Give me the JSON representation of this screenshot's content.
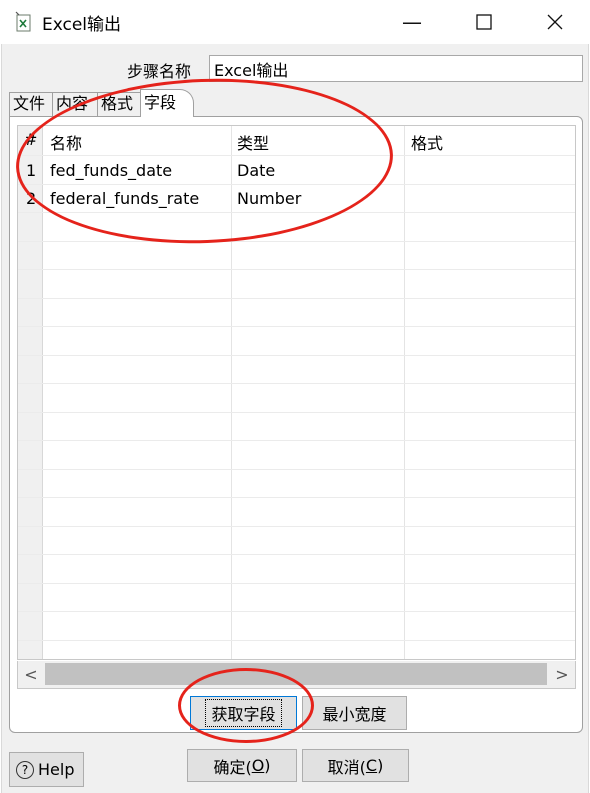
{
  "window": {
    "title": "Excel输出",
    "minimize_glyph": "—",
    "maximize_glyph": "☐",
    "close_glyph": "✕"
  },
  "step": {
    "label": "步骤名称",
    "value": "Excel输出"
  },
  "tabs": [
    {
      "label": "文件",
      "active": false
    },
    {
      "label": "内容",
      "active": false
    },
    {
      "label": "格式",
      "active": false
    },
    {
      "label": "字段",
      "active": true
    }
  ],
  "table": {
    "columns": [
      "#",
      "名称",
      "类型",
      "格式"
    ],
    "rows": [
      {
        "num": "1",
        "name": "fed_funds_date",
        "type": "Date",
        "format": ""
      },
      {
        "num": "2",
        "name": "federal_funds_rate",
        "type": "Number",
        "format": ""
      }
    ]
  },
  "scroll": {
    "left_glyph": "<",
    "right_glyph": ">"
  },
  "buttons": {
    "get_fields": "获取字段",
    "min_width": "最小宽度",
    "help": "Help",
    "ok_prefix": "确定(",
    "ok_key": "O",
    "ok_suffix": ")",
    "cancel_prefix": "取消(",
    "cancel_key": "C",
    "cancel_suffix": ")"
  },
  "icons": {
    "app": "excel-output-icon",
    "help": "question-circle-icon"
  },
  "colors": {
    "annotation": "#e5231b",
    "focus_border": "#0078d7"
  }
}
